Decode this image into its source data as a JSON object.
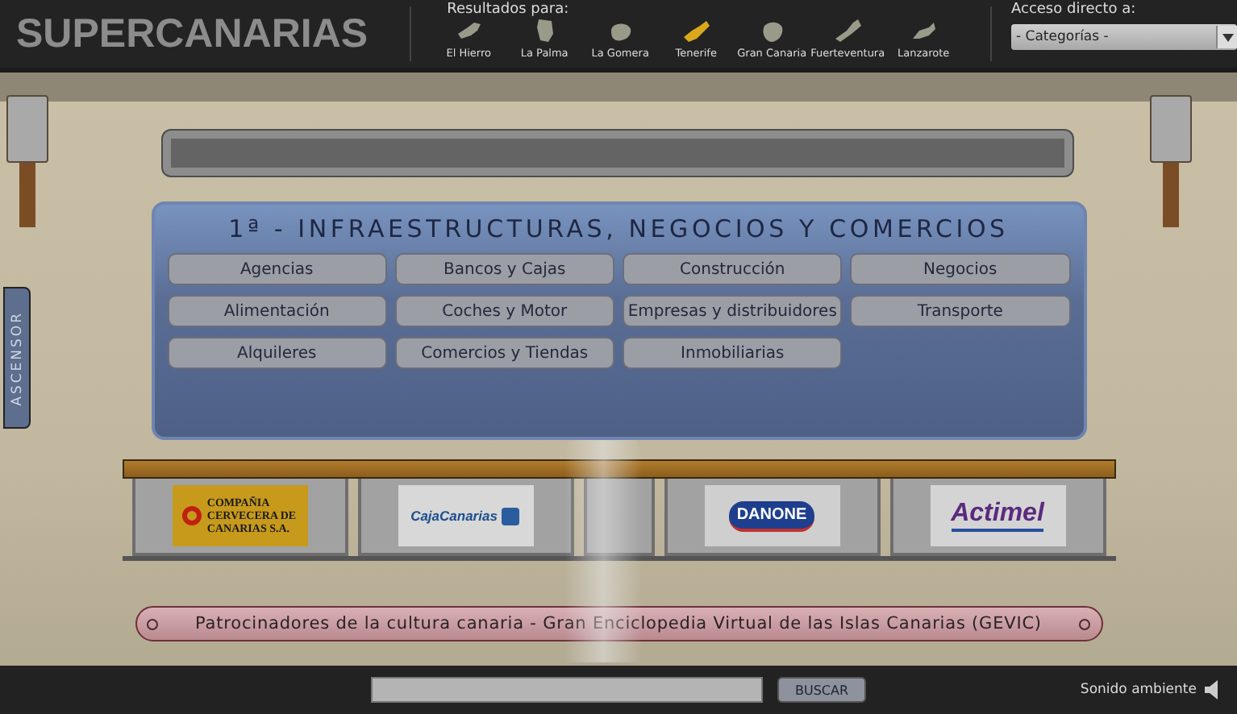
{
  "header": {
    "logo": "SUPERCANARIAS",
    "results_label": "Resultados para:",
    "islands": [
      {
        "name": "El Hierro",
        "selected": false
      },
      {
        "name": "La Palma",
        "selected": false
      },
      {
        "name": "La Gomera",
        "selected": false
      },
      {
        "name": "Tenerife",
        "selected": true
      },
      {
        "name": "Gran Canaria",
        "selected": false
      },
      {
        "name": "Fuerteventura",
        "selected": false
      },
      {
        "name": "Lanzarote",
        "selected": false
      }
    ],
    "direct_access": {
      "label": "Acceso directo a:",
      "value": "- Categorías -"
    }
  },
  "side_tab": "ASCENSOR",
  "panel": {
    "title": "1ª - INFRAESTRUCTURAS, NEGOCIOS Y COMERCIOS",
    "categories": [
      "Agencias",
      "Bancos y Cajas",
      "Construcción",
      "Negocios",
      "Alimentación",
      "Coches y Motor",
      "Empresas y distribuidores",
      "Transporte",
      "Alquileres",
      "Comercios y Tiendas",
      "Inmobiliarias"
    ]
  },
  "sponsors": [
    {
      "kind": "brewery",
      "lines": [
        "COMPAÑIA",
        "CERVECERA DE",
        "CANARIAS S.A."
      ]
    },
    {
      "kind": "bank",
      "lines": [
        "CajaCanarias"
      ]
    },
    {
      "kind": "empty"
    },
    {
      "kind": "dairy",
      "lines": [
        "DANONE"
      ]
    },
    {
      "kind": "yogurt",
      "lines": [
        "Actimel"
      ]
    }
  ],
  "banner": "Patrocinadores de la cultura canaria - Gran Enciclopedia Virtual de las Islas Canarias (GEVIC)",
  "footer": {
    "search_button": "BUSCAR",
    "sound_label": "Sonido ambiente"
  }
}
